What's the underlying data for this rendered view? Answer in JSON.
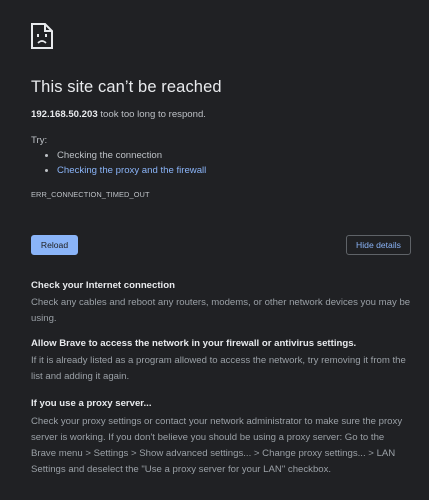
{
  "icon": "sad-page-icon",
  "title": "This site can’t be reached",
  "host": "192.168.50.203",
  "host_suffix": " took too long to respond.",
  "try_label": "Try:",
  "suggestions": [
    {
      "label": "Checking the connection",
      "link": false
    },
    {
      "label": "Checking the proxy and the firewall",
      "link": true
    }
  ],
  "error_code": "ERR_CONNECTION_TIMED_OUT",
  "buttons": {
    "reload": "Reload",
    "details": "Hide details"
  },
  "details": [
    {
      "heading": "Check your Internet connection",
      "body": "Check any cables and reboot any routers, modems, or other network devices you may be using."
    },
    {
      "heading": "Allow Brave to access the network in your firewall or antivirus settings.",
      "body": "If it is already listed as a program allowed to access the network, try removing it from the list and adding it again."
    },
    {
      "heading": "If you use a proxy server...",
      "body": "Check your proxy settings or contact your network administrator to make sure the proxy server is working. If you don't believe you should be using a proxy server: Go to the Brave menu > Settings > Show advanced settings... > Change proxy settings... > LAN Settings and deselect the \"Use a proxy server for your LAN\" checkbox."
    }
  ],
  "colors": {
    "background": "#202124",
    "text": "#e8eaed",
    "secondary_text": "#9aa0a6",
    "link": "#8ab4f8",
    "button_primary": "#8ab4f8"
  }
}
